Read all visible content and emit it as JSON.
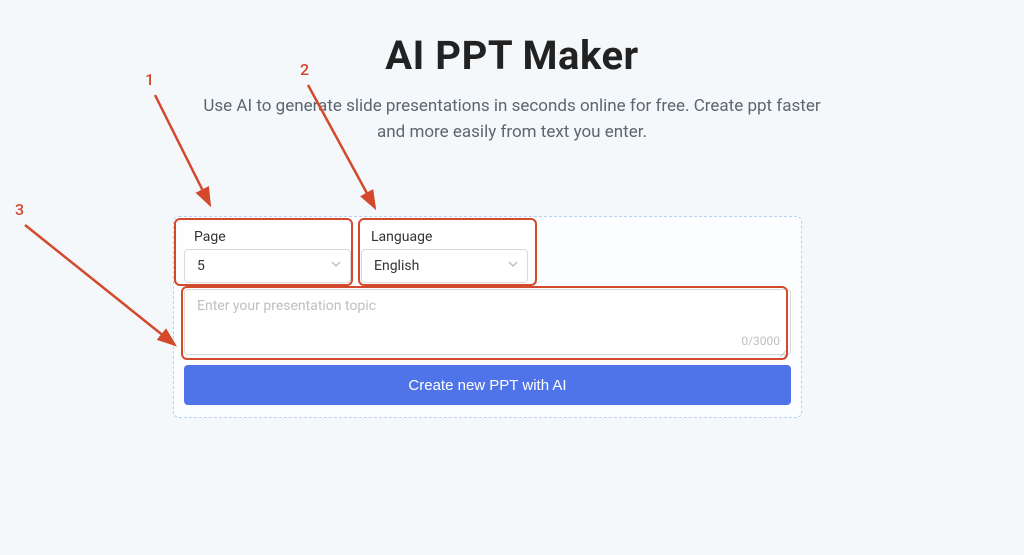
{
  "header": {
    "title": "AI PPT Maker",
    "subtitle": "Use AI to generate slide presentations in seconds online for free. Create ppt faster and more easily from text you enter."
  },
  "form": {
    "page_label": "Page",
    "page_value": "5",
    "language_label": "Language",
    "language_value": "English",
    "topic_placeholder": "Enter your presentation topic",
    "topic_value": "",
    "char_counter": "0/3000",
    "submit_label": "Create new PPT with AI"
  },
  "annotations": {
    "n1": "1",
    "n2": "2",
    "n3": "3"
  }
}
